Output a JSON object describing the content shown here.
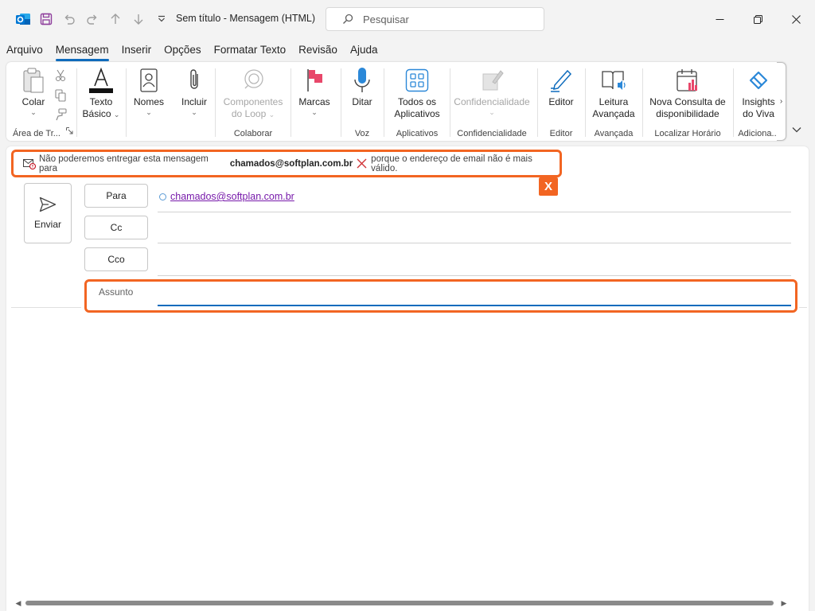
{
  "window": {
    "title": "Sem título  -  Mensagem (HTML)",
    "search_placeholder": "Pesquisar"
  },
  "tabs": [
    {
      "label": "Arquivo"
    },
    {
      "label": "Mensagem",
      "active": true
    },
    {
      "label": "Inserir"
    },
    {
      "label": "Opções"
    },
    {
      "label": "Formatar Texto"
    },
    {
      "label": "Revisão"
    },
    {
      "label": "Ajuda"
    }
  ],
  "ribbon": {
    "clipboard": {
      "group": "Área de Tr...",
      "paste": "Colar"
    },
    "basic_text": {
      "line1": "Texto",
      "line2": "Básico"
    },
    "names": {
      "label": "Nomes"
    },
    "include": {
      "label": "Incluir"
    },
    "loop": {
      "line1": "Componentes",
      "line2": "do Loop",
      "group": "Colaborar"
    },
    "tags": {
      "label": "Marcas"
    },
    "dictate": {
      "label": "Ditar",
      "group": "Voz"
    },
    "apps": {
      "line1": "Todos os",
      "line2": "Aplicativos",
      "group": "Aplicativos"
    },
    "sensitivity": {
      "label": "Confidencialidade",
      "group": "Confidencialidade"
    },
    "editor": {
      "label": "Editor",
      "group": "Editor"
    },
    "reader": {
      "line1": "Leitura",
      "line2": "Avançada",
      "group": "Avançada"
    },
    "scheduling": {
      "line1": "Nova Consulta de",
      "line2": "disponibilidade",
      "group": "Localizar Horário"
    },
    "viva": {
      "line1": "Insights",
      "line2": "do Viva",
      "group": "Adiciona..."
    }
  },
  "infobar": {
    "prefix": "Não poderemos entregar esta mensagem para",
    "email": "chamados@softplan.com.br",
    "suffix": "porque o endereço de email não é mais válido.",
    "badge": "X"
  },
  "compose": {
    "send": "Enviar",
    "to": "Para",
    "cc": "Cc",
    "bcc": "Cco",
    "recipient": "chamados@softplan.com.br",
    "subject_label": "Assunto",
    "subject_value": ""
  },
  "colors": {
    "accent": "#0f6cbd",
    "highlight": "#f26522",
    "outlook_blue": "#0078d4",
    "link_purple": "#7719aa"
  }
}
